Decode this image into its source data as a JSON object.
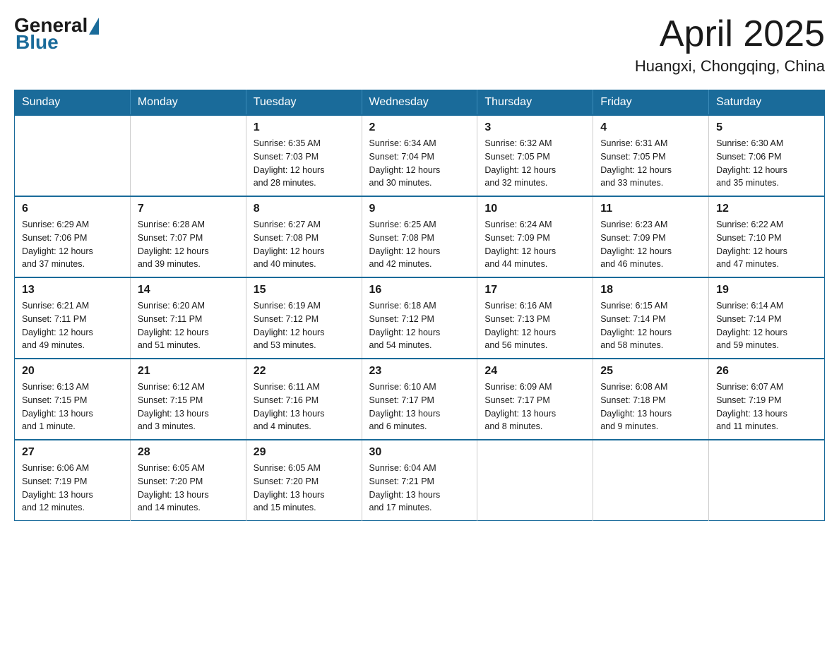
{
  "header": {
    "logo_general": "General",
    "logo_blue": "Blue",
    "month_title": "April 2025",
    "location": "Huangxi, Chongqing, China"
  },
  "weekdays": [
    "Sunday",
    "Monday",
    "Tuesday",
    "Wednesday",
    "Thursday",
    "Friday",
    "Saturday"
  ],
  "weeks": [
    [
      {
        "day": "",
        "info": ""
      },
      {
        "day": "",
        "info": ""
      },
      {
        "day": "1",
        "info": "Sunrise: 6:35 AM\nSunset: 7:03 PM\nDaylight: 12 hours\nand 28 minutes."
      },
      {
        "day": "2",
        "info": "Sunrise: 6:34 AM\nSunset: 7:04 PM\nDaylight: 12 hours\nand 30 minutes."
      },
      {
        "day": "3",
        "info": "Sunrise: 6:32 AM\nSunset: 7:05 PM\nDaylight: 12 hours\nand 32 minutes."
      },
      {
        "day": "4",
        "info": "Sunrise: 6:31 AM\nSunset: 7:05 PM\nDaylight: 12 hours\nand 33 minutes."
      },
      {
        "day": "5",
        "info": "Sunrise: 6:30 AM\nSunset: 7:06 PM\nDaylight: 12 hours\nand 35 minutes."
      }
    ],
    [
      {
        "day": "6",
        "info": "Sunrise: 6:29 AM\nSunset: 7:06 PM\nDaylight: 12 hours\nand 37 minutes."
      },
      {
        "day": "7",
        "info": "Sunrise: 6:28 AM\nSunset: 7:07 PM\nDaylight: 12 hours\nand 39 minutes."
      },
      {
        "day": "8",
        "info": "Sunrise: 6:27 AM\nSunset: 7:08 PM\nDaylight: 12 hours\nand 40 minutes."
      },
      {
        "day": "9",
        "info": "Sunrise: 6:25 AM\nSunset: 7:08 PM\nDaylight: 12 hours\nand 42 minutes."
      },
      {
        "day": "10",
        "info": "Sunrise: 6:24 AM\nSunset: 7:09 PM\nDaylight: 12 hours\nand 44 minutes."
      },
      {
        "day": "11",
        "info": "Sunrise: 6:23 AM\nSunset: 7:09 PM\nDaylight: 12 hours\nand 46 minutes."
      },
      {
        "day": "12",
        "info": "Sunrise: 6:22 AM\nSunset: 7:10 PM\nDaylight: 12 hours\nand 47 minutes."
      }
    ],
    [
      {
        "day": "13",
        "info": "Sunrise: 6:21 AM\nSunset: 7:11 PM\nDaylight: 12 hours\nand 49 minutes."
      },
      {
        "day": "14",
        "info": "Sunrise: 6:20 AM\nSunset: 7:11 PM\nDaylight: 12 hours\nand 51 minutes."
      },
      {
        "day": "15",
        "info": "Sunrise: 6:19 AM\nSunset: 7:12 PM\nDaylight: 12 hours\nand 53 minutes."
      },
      {
        "day": "16",
        "info": "Sunrise: 6:18 AM\nSunset: 7:12 PM\nDaylight: 12 hours\nand 54 minutes."
      },
      {
        "day": "17",
        "info": "Sunrise: 6:16 AM\nSunset: 7:13 PM\nDaylight: 12 hours\nand 56 minutes."
      },
      {
        "day": "18",
        "info": "Sunrise: 6:15 AM\nSunset: 7:14 PM\nDaylight: 12 hours\nand 58 minutes."
      },
      {
        "day": "19",
        "info": "Sunrise: 6:14 AM\nSunset: 7:14 PM\nDaylight: 12 hours\nand 59 minutes."
      }
    ],
    [
      {
        "day": "20",
        "info": "Sunrise: 6:13 AM\nSunset: 7:15 PM\nDaylight: 13 hours\nand 1 minute."
      },
      {
        "day": "21",
        "info": "Sunrise: 6:12 AM\nSunset: 7:15 PM\nDaylight: 13 hours\nand 3 minutes."
      },
      {
        "day": "22",
        "info": "Sunrise: 6:11 AM\nSunset: 7:16 PM\nDaylight: 13 hours\nand 4 minutes."
      },
      {
        "day": "23",
        "info": "Sunrise: 6:10 AM\nSunset: 7:17 PM\nDaylight: 13 hours\nand 6 minutes."
      },
      {
        "day": "24",
        "info": "Sunrise: 6:09 AM\nSunset: 7:17 PM\nDaylight: 13 hours\nand 8 minutes."
      },
      {
        "day": "25",
        "info": "Sunrise: 6:08 AM\nSunset: 7:18 PM\nDaylight: 13 hours\nand 9 minutes."
      },
      {
        "day": "26",
        "info": "Sunrise: 6:07 AM\nSunset: 7:19 PM\nDaylight: 13 hours\nand 11 minutes."
      }
    ],
    [
      {
        "day": "27",
        "info": "Sunrise: 6:06 AM\nSunset: 7:19 PM\nDaylight: 13 hours\nand 12 minutes."
      },
      {
        "day": "28",
        "info": "Sunrise: 6:05 AM\nSunset: 7:20 PM\nDaylight: 13 hours\nand 14 minutes."
      },
      {
        "day": "29",
        "info": "Sunrise: 6:05 AM\nSunset: 7:20 PM\nDaylight: 13 hours\nand 15 minutes."
      },
      {
        "day": "30",
        "info": "Sunrise: 6:04 AM\nSunset: 7:21 PM\nDaylight: 13 hours\nand 17 minutes."
      },
      {
        "day": "",
        "info": ""
      },
      {
        "day": "",
        "info": ""
      },
      {
        "day": "",
        "info": ""
      }
    ]
  ]
}
